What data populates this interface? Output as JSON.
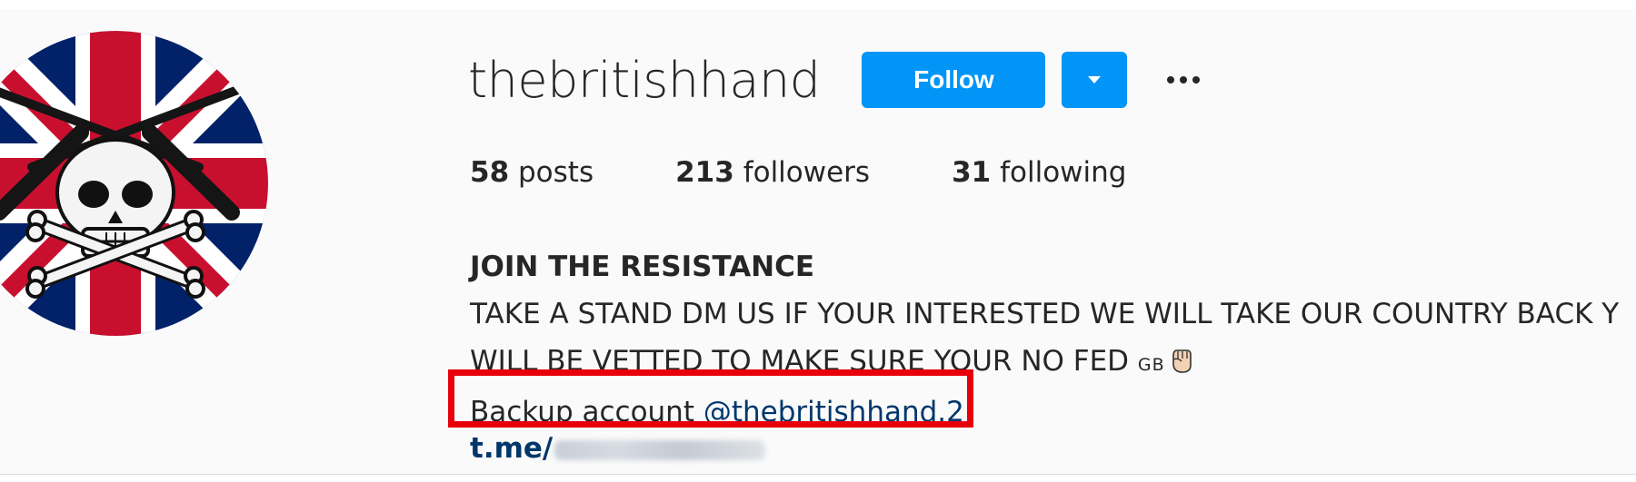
{
  "profile": {
    "username": "thebritishhand",
    "follow_label": "Follow",
    "dropdown_icon": "chevron-down-icon",
    "more_icon": "more-options-icon",
    "avatar_icon": "union-jack-skull-avatar",
    "accent_color": "#0095f6",
    "highlight_color": "#e8000b"
  },
  "stats": {
    "posts_count": "58",
    "posts_label": "posts",
    "followers_count": "213",
    "followers_label": "followers",
    "following_count": "31",
    "following_label": "following"
  },
  "bio": {
    "name": "JOIN THE RESISTANCE",
    "line1": "TAKE A STAND DM US IF YOUR INTERESTED WE WILL TAKE OUR COUNTRY BACK Y",
    "line2": "WILL BE VETTED TO MAKE SURE YOUR NO FED ",
    "flag_code": "GB",
    "fist_icon": "raised-fist-icon",
    "backup_label": "Backup account ",
    "backup_mention": "@thebritishhand.2",
    "link_prefix": "t.me/"
  }
}
